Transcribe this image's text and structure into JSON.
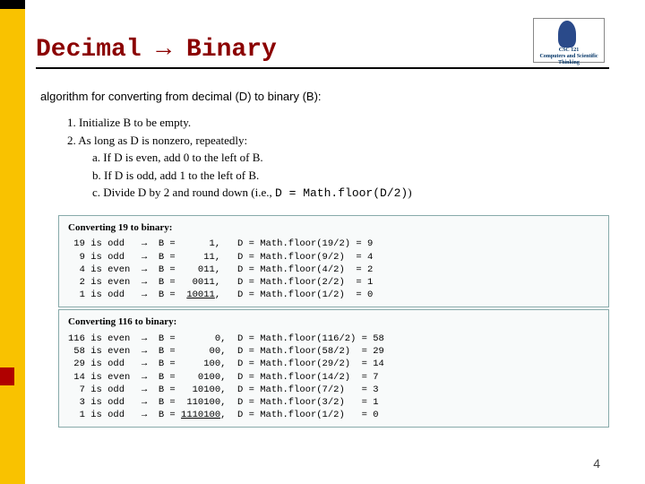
{
  "logo": {
    "course": "CSC 121",
    "tagline": "Computers and Scientific Thinking"
  },
  "title": "Decimal → Binary",
  "intro": "algorithm for converting from decimal (D) to binary (B):",
  "algo": {
    "step1_num": "1.",
    "step1": "Initialize B to be empty.",
    "step2_num": "2.",
    "step2": "As long as D is nonzero, repeatedly:",
    "a_num": "a.",
    "a": "If D is even, add 0 to the left of B.",
    "b_num": "b.",
    "b": "If D is odd, add 1 to the left of B.",
    "c_num": "c.",
    "c_pre": "Divide D by 2 and round down (i.e., ",
    "c_code": "D = Math.floor(D/2)",
    "c_post": ")"
  },
  "box1": {
    "title": "Converting 19 to binary:",
    "rows": [
      " 19 is odd   →  B =      1,   D = Math.floor(19/2) = 9",
      "  9 is odd   →  B =     11,   D = Math.floor(9/2)  = 4",
      "  4 is even  →  B =    011,   D = Math.floor(4/2)  = 2",
      "  2 is even  →  B =   0011,   D = Math.floor(2/2)  = 1",
      "  1 is odd   →  B =  ",
      "10011",
      ",   D = Math.floor(1/2)  = 0"
    ]
  },
  "box2": {
    "title": "Converting 116 to binary:",
    "rows": [
      "116 is even  →  B =       0,  D = Math.floor(116/2) = 58",
      " 58 is even  →  B =      00,  D = Math.floor(58/2)  = 29",
      " 29 is odd   →  B =     100,  D = Math.floor(29/2)  = 14",
      " 14 is even  →  B =    0100,  D = Math.floor(14/2)  = 7",
      "  7 is odd   →  B =   10100,  D = Math.floor(7/2)   = 3",
      "  3 is odd   →  B =  110100,  D = Math.floor(3/2)   = 1",
      "  1 is odd   →  B = ",
      "1110100",
      ",  D = Math.floor(1/2)   = 0"
    ]
  },
  "pagenum": "4"
}
